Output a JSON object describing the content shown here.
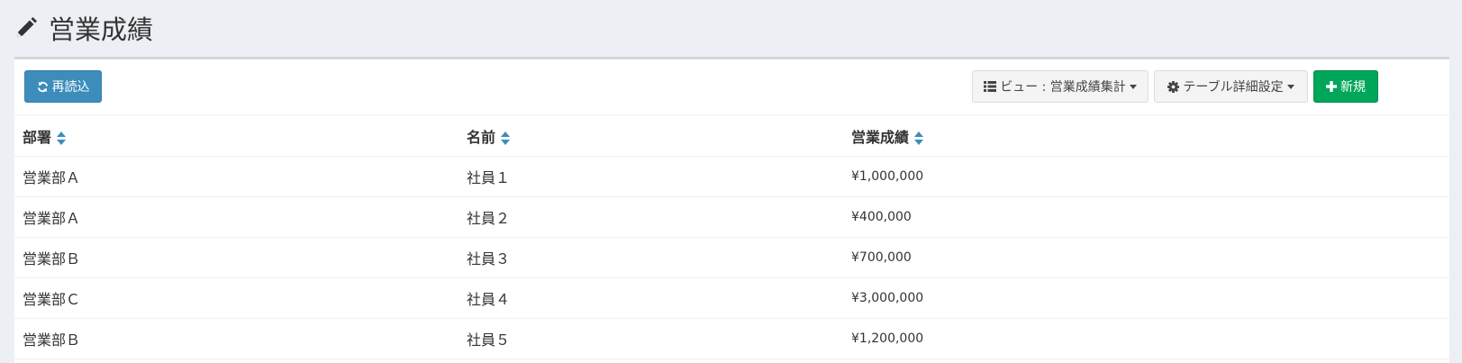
{
  "page": {
    "title": "営業成績"
  },
  "toolbar": {
    "reload_label": "再読込",
    "view_label": "ビュー : 営業成績集計",
    "settings_label": "テーブル詳細設定",
    "new_label": "新規"
  },
  "table": {
    "columns": [
      "部署",
      "名前",
      "営業成績"
    ],
    "rows": [
      [
        "営業部Ａ",
        "社員１",
        "¥1,000,000"
      ],
      [
        "営業部Ａ",
        "社員２",
        "¥400,000"
      ],
      [
        "営業部Ｂ",
        "社員３",
        "¥700,000"
      ],
      [
        "営業部Ｃ",
        "社員４",
        "¥3,000,000"
      ],
      [
        "営業部Ｂ",
        "社員５",
        "¥1,200,000"
      ]
    ]
  },
  "colors": {
    "background": "#ecf0f5",
    "primary": "#3c8dbc",
    "success": "#00a65a",
    "sort_icon": "#3c8dbc"
  },
  "icons": {
    "title": "pencil-icon",
    "reload": "refresh-icon",
    "view": "list-icon",
    "settings": "gear-icon",
    "new": "plus-icon",
    "sort": "sort-icon"
  }
}
